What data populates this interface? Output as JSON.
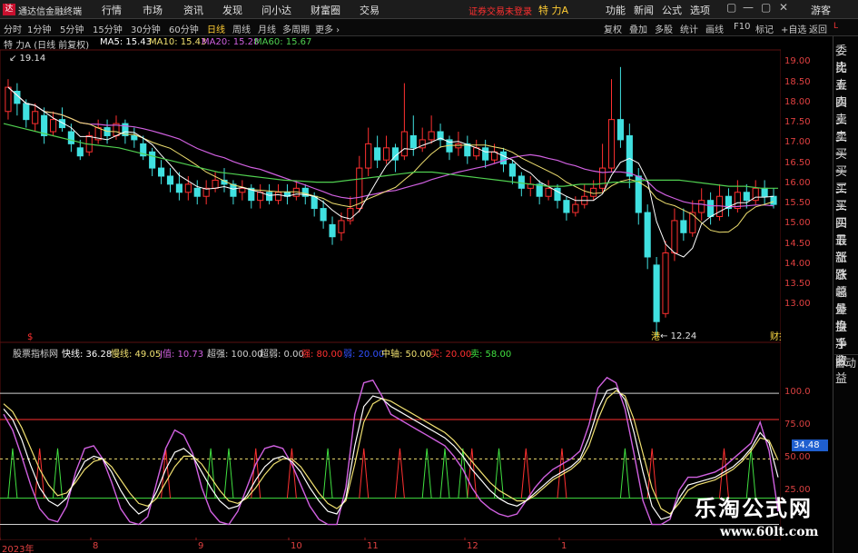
{
  "app": {
    "logo_glyph": "达",
    "name": "通达信金融终端"
  },
  "menu": [
    "行情",
    "市场",
    "资讯",
    "发现",
    "问小达",
    "财富圈",
    "交易"
  ],
  "broker_notice": "证券交易未登录",
  "stock_tag": "特 力A",
  "menu_right": [
    "功能",
    "新闻",
    "公式",
    "选项"
  ],
  "window_buttons": [
    "▢",
    "—",
    "▢",
    "✕"
  ],
  "user_label": "游客",
  "periods": [
    "分时",
    "1分钟",
    "5分钟",
    "15分钟",
    "30分钟",
    "60分钟",
    "日线",
    "周线",
    "月线",
    "多周期",
    "更多 ›"
  ],
  "active_period": "日线",
  "tools": [
    "复权",
    "叠加",
    "多股",
    "统计",
    "画线",
    "F10",
    "标记",
    "+自选",
    "返回"
  ],
  "side_tag": "L",
  "side_panel": [
    "委比",
    "卖五",
    "卖四",
    "卖三",
    "卖二",
    "卖一",
    "买一",
    "买二",
    "买三",
    "买四",
    "买五",
    "最新",
    "涨跌",
    "涨幅",
    "总量",
    "外盘",
    "换手",
    "净资",
    "收益"
  ],
  "side_auto": "自动",
  "upper_legend": {
    "title": "特 力A (日线 前复权)",
    "items": [
      {
        "label": "MA5: 15.43",
        "color": "#ffffff"
      },
      {
        "label": "MA10: 15.43",
        "color": "#f0e070"
      },
      {
        "label": "MA20: 15.28",
        "color": "#d060e0"
      },
      {
        "label": "MA60: 15.67",
        "color": "#50d050"
      }
    ]
  },
  "lower_legend": {
    "title": "股票指标网",
    "items": [
      {
        "label": "快线: 36.28",
        "color": "#ffffff"
      },
      {
        "label": "慢线: 49.05",
        "color": "#f0e070"
      },
      {
        "label": "J值: 10.73",
        "color": "#d060e0"
      },
      {
        "label": "超强: 100.00",
        "color": "#d0d0d0"
      },
      {
        "label": "超弱: 0.00",
        "color": "#d0d0d0"
      },
      {
        "label": "强: 80.00",
        "color": "#ff3030"
      },
      {
        "label": "弱: 20.00",
        "color": "#3050ff"
      },
      {
        "label": "中轴: 50.00",
        "color": "#f0e070"
      },
      {
        "label": "买: 20.00",
        "color": "#ff3030"
      },
      {
        "label": "卖: 58.00",
        "color": "#40e040"
      }
    ]
  },
  "price_axis": [
    "19.00",
    "18.50",
    "18.00",
    "17.50",
    "17.00",
    "16.50",
    "16.00",
    "15.50",
    "15.00",
    "14.50",
    "14.00",
    "13.50",
    "13.00"
  ],
  "indicator_axis": [
    "100.0",
    "75.00",
    "50.00",
    "25.00"
  ],
  "current_value": "34.48",
  "price_annotations": {
    "high": "19.14",
    "low": "12.24",
    "low_marker": "港",
    "report_marker": "财报",
    "dividend_marker": "$"
  },
  "date_axis": [
    "2023年",
    "8",
    "9",
    "10",
    "11",
    "12",
    "1"
  ],
  "watermark": {
    "title": "乐淘公式网",
    "url": "www.60lt.com"
  },
  "colors": {
    "up": "#ff3030",
    "down": "#40e0e0",
    "ma5": "#ffffff",
    "ma10": "#f0e070",
    "ma20": "#d060e0",
    "ma60": "#50d050"
  },
  "chart_data": {
    "type": "line",
    "title": "特 力A (日线 前复权)",
    "price_range": [
      12.2,
      19.3
    ],
    "candles": [
      [
        17.8,
        18.4,
        18.6,
        17.6
      ],
      [
        18.3,
        18.0,
        18.5,
        17.7
      ],
      [
        18.0,
        17.6,
        18.1,
        17.4
      ],
      [
        17.5,
        17.8,
        18.0,
        17.3
      ],
      [
        17.7,
        17.2,
        17.9,
        17.0
      ],
      [
        17.3,
        17.6,
        17.8,
        17.2
      ],
      [
        17.6,
        17.4,
        17.9,
        17.3
      ],
      [
        17.3,
        17.0,
        17.5,
        16.8
      ],
      [
        16.9,
        16.7,
        17.1,
        16.6
      ],
      [
        16.8,
        17.2,
        17.3,
        16.7
      ],
      [
        17.1,
        17.4,
        17.6,
        17.0
      ],
      [
        17.4,
        17.2,
        17.6,
        17.0
      ],
      [
        17.2,
        17.5,
        17.7,
        17.1
      ],
      [
        17.5,
        17.2,
        17.6,
        17.0
      ],
      [
        17.2,
        17.1,
        17.4,
        16.9
      ],
      [
        17.0,
        16.7,
        17.2,
        16.6
      ],
      [
        16.8,
        16.4,
        16.9,
        16.2
      ],
      [
        16.4,
        16.2,
        16.6,
        16.0
      ],
      [
        16.2,
        16.0,
        16.4,
        15.8
      ],
      [
        16.0,
        15.8,
        16.3,
        15.6
      ],
      [
        15.8,
        16.0,
        16.2,
        15.6
      ],
      [
        15.9,
        15.7,
        16.1,
        15.5
      ],
      [
        15.7,
        15.9,
        16.1,
        15.5
      ],
      [
        15.9,
        16.1,
        16.3,
        15.8
      ],
      [
        16.1,
        16.0,
        16.4,
        15.8
      ],
      [
        16.0,
        15.7,
        16.1,
        15.5
      ],
      [
        15.8,
        15.9,
        16.1,
        15.6
      ],
      [
        15.9,
        15.6,
        16.0,
        15.4
      ],
      [
        15.6,
        15.8,
        16.0,
        15.4
      ],
      [
        15.8,
        15.6,
        16.0,
        15.5
      ],
      [
        15.6,
        15.8,
        16.0,
        15.5
      ],
      [
        15.8,
        15.7,
        16.0,
        15.5
      ],
      [
        15.7,
        15.9,
        16.1,
        15.6
      ],
      [
        15.9,
        15.7,
        16.0,
        15.5
      ],
      [
        15.7,
        15.4,
        15.8,
        15.2
      ],
      [
        15.4,
        15.1,
        15.6,
        14.9
      ],
      [
        15.0,
        14.7,
        15.2,
        14.5
      ],
      [
        14.8,
        15.1,
        15.3,
        14.6
      ],
      [
        15.1,
        15.4,
        15.7,
        15.0
      ],
      [
        15.4,
        16.4,
        16.7,
        15.3
      ],
      [
        16.4,
        17.0,
        17.4,
        16.2
      ],
      [
        16.9,
        16.6,
        17.2,
        16.4
      ],
      [
        16.6,
        16.9,
        17.2,
        16.5
      ],
      [
        16.9,
        16.6,
        17.0,
        16.3
      ],
      [
        16.7,
        17.3,
        18.5,
        16.6
      ],
      [
        17.2,
        16.9,
        17.7,
        16.7
      ],
      [
        16.9,
        17.1,
        17.4,
        16.8
      ],
      [
        17.1,
        17.3,
        17.7,
        17.0
      ],
      [
        17.3,
        17.1,
        17.5,
        16.9
      ],
      [
        17.1,
        16.8,
        17.2,
        16.6
      ],
      [
        16.9,
        17.0,
        17.3,
        16.7
      ],
      [
        17.0,
        16.7,
        17.2,
        16.5
      ],
      [
        16.7,
        16.9,
        17.1,
        16.6
      ],
      [
        16.9,
        16.6,
        17.1,
        16.4
      ],
      [
        16.6,
        16.8,
        17.0,
        16.5
      ],
      [
        16.8,
        16.5,
        16.9,
        16.3
      ],
      [
        16.5,
        16.2,
        16.6,
        16.0
      ],
      [
        16.2,
        15.9,
        16.3,
        15.7
      ],
      [
        15.9,
        16.0,
        16.2,
        15.7
      ],
      [
        16.0,
        15.7,
        16.1,
        15.5
      ],
      [
        15.7,
        15.9,
        16.1,
        15.6
      ],
      [
        15.9,
        15.6,
        16.0,
        15.4
      ],
      [
        15.6,
        15.3,
        15.7,
        15.1
      ],
      [
        15.3,
        15.5,
        15.7,
        15.2
      ],
      [
        15.5,
        15.7,
        16.0,
        15.4
      ],
      [
        15.7,
        15.9,
        16.1,
        15.6
      ],
      [
        15.9,
        16.4,
        17.0,
        15.8
      ],
      [
        16.4,
        17.6,
        18.6,
        16.3
      ],
      [
        17.6,
        17.1,
        18.9,
        16.9
      ],
      [
        17.2,
        16.2,
        17.5,
        15.9
      ],
      [
        16.2,
        15.3,
        16.4,
        15.0
      ],
      [
        15.3,
        14.2,
        15.5,
        13.9
      ],
      [
        14.0,
        12.6,
        14.2,
        12.24
      ],
      [
        12.8,
        14.3,
        14.6,
        12.7
      ],
      [
        14.3,
        15.1,
        15.4,
        14.1
      ],
      [
        15.1,
        14.8,
        15.4,
        14.6
      ],
      [
        14.8,
        15.3,
        15.6,
        14.7
      ],
      [
        15.3,
        15.6,
        15.9,
        15.1
      ],
      [
        15.6,
        15.2,
        15.8,
        15.0
      ],
      [
        15.2,
        15.7,
        16.0,
        15.1
      ],
      [
        15.7,
        15.4,
        15.9,
        15.2
      ],
      [
        15.4,
        15.8,
        16.1,
        15.3
      ],
      [
        15.8,
        15.6,
        16.0,
        15.4
      ],
      [
        15.6,
        15.9,
        16.1,
        15.5
      ],
      [
        15.9,
        15.7,
        16.1,
        15.5
      ],
      [
        15.7,
        15.5,
        15.9,
        15.4
      ]
    ],
    "ma60": [
      17.5,
      17.4,
      17.3,
      17.2,
      17.1,
      17.0,
      16.95,
      16.9,
      16.8,
      16.7,
      16.6,
      16.5,
      16.4,
      16.3,
      16.25,
      16.2,
      16.15,
      16.1,
      16.08,
      16.05,
      16.05,
      16.1,
      16.15,
      16.2,
      16.25,
      16.3,
      16.3,
      16.25,
      16.2,
      16.15,
      16.1,
      16.05,
      16.0,
      15.95,
      15.95,
      16.0,
      16.0,
      16.05,
      16.05,
      16.1,
      16.1,
      16.1,
      16.05,
      16.0,
      15.95,
      15.95,
      15.9,
      15.9
    ],
    "oscillator": {
      "fast": [
        88,
        80,
        65,
        45,
        28,
        18,
        14,
        20,
        35,
        48,
        52,
        50,
        40,
        26,
        15,
        8,
        12,
        25,
        42,
        55,
        58,
        52,
        40,
        28,
        18,
        12,
        14,
        22,
        34,
        44,
        50,
        52,
        48,
        40,
        28,
        18,
        10,
        8,
        20,
        60,
        90,
        98,
        96,
        90,
        86,
        82,
        78,
        74,
        70,
        66,
        60,
        52,
        42,
        34,
        26,
        20,
        16,
        14,
        18,
        24,
        30,
        36,
        40,
        44,
        50,
        66,
        88,
        102,
        104,
        95,
        70,
        40,
        14,
        4,
        6,
        20,
        30,
        32,
        34,
        36,
        40,
        44,
        50,
        58,
        70,
        62,
        36
      ],
      "slow": [
        92,
        86,
        74,
        58,
        42,
        30,
        22,
        24,
        32,
        42,
        48,
        50,
        44,
        34,
        24,
        16,
        14,
        20,
        32,
        44,
        52,
        52,
        46,
        36,
        26,
        18,
        16,
        20,
        28,
        38,
        46,
        50,
        50,
        44,
        34,
        24,
        16,
        12,
        18,
        46,
        78,
        92,
        96,
        94,
        90,
        86,
        82,
        78,
        74,
        70,
        64,
        56,
        48,
        40,
        32,
        26,
        22,
        18,
        18,
        22,
        28,
        34,
        38,
        42,
        48,
        60,
        80,
        96,
        102,
        98,
        80,
        54,
        28,
        12,
        8,
        16,
        26,
        30,
        32,
        34,
        38,
        42,
        48,
        56,
        66,
        64,
        49
      ],
      "j": [
        84,
        72,
        52,
        30,
        12,
        4,
        2,
        14,
        40,
        58,
        60,
        50,
        32,
        12,
        2,
        0,
        6,
        32,
        58,
        72,
        68,
        54,
        28,
        10,
        2,
        0,
        10,
        28,
        46,
        58,
        60,
        58,
        46,
        30,
        14,
        4,
        0,
        0,
        28,
        84,
        108,
        110,
        98,
        84,
        80,
        76,
        72,
        68,
        64,
        60,
        52,
        42,
        28,
        18,
        12,
        8,
        6,
        8,
        18,
        28,
        36,
        42,
        46,
        50,
        56,
        76,
        104,
        112,
        108,
        88,
        54,
        18,
        0,
        0,
        4,
        26,
        36,
        36,
        38,
        40,
        44,
        50,
        56,
        62,
        78,
        56,
        10
      ],
      "bands": {
        "super_strong": 100,
        "strong": 80,
        "mid": 50,
        "weak": 20,
        "super_weak": 0
      },
      "buy_signals": [
        4,
        18,
        28,
        32,
        40,
        44,
        52,
        58,
        62,
        72,
        80
      ],
      "sell_signals": [
        1,
        6,
        23,
        25,
        36,
        47,
        49,
        51,
        55,
        69,
        83
      ]
    }
  }
}
